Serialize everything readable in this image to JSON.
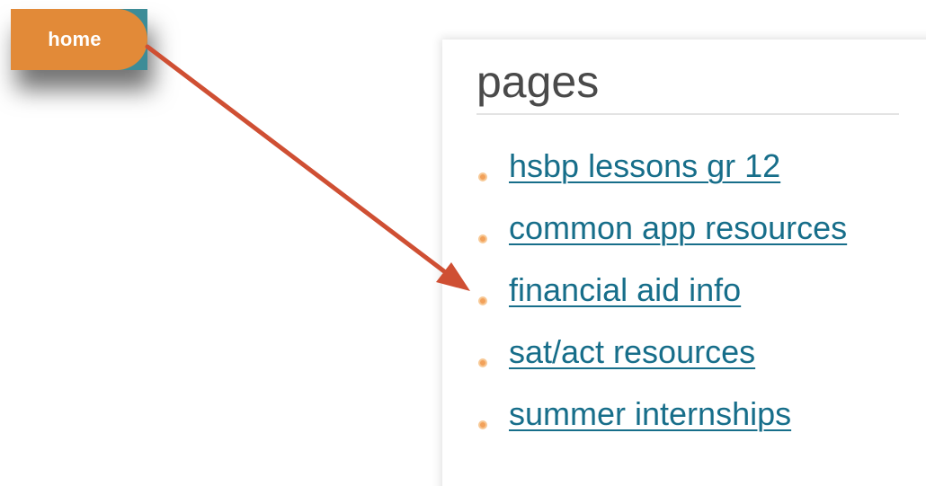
{
  "nav": {
    "home_label": "home"
  },
  "pages": {
    "title": "pages",
    "items": [
      "hsbp lessons gr 12",
      "common app resources",
      "financial aid info",
      "sat/act resources",
      "summer internships"
    ]
  },
  "colors": {
    "home_tab": "#e28a38",
    "home_tab_edge": "#3d8c97",
    "link": "#176e8a",
    "bullet": "#f2a15a",
    "arrow": "#cf4f33"
  },
  "icons": {
    "bullet": "bullet-dot-icon",
    "arrow": "annotation-arrow-icon"
  }
}
